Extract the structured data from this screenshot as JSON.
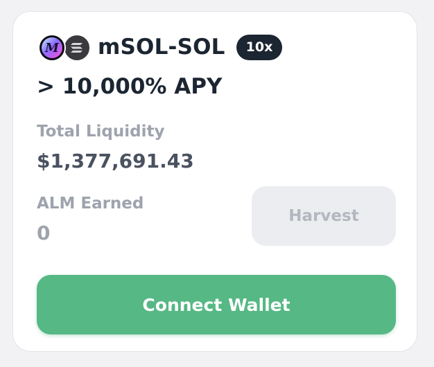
{
  "pool": {
    "token_a_icon": "msol-token-icon",
    "token_b_icon": "sol-token-icon",
    "pair_name": "mSOL-SOL",
    "leverage": "10x",
    "apy": "> 10,000% APY"
  },
  "stats": {
    "liquidity_label": "Total Liquidity",
    "liquidity_value": "$1,377,691.43",
    "earned_label": "ALM Earned",
    "earned_value": "0"
  },
  "actions": {
    "harvest_label": "Harvest",
    "connect_label": "Connect Wallet"
  },
  "colors": {
    "primary_text": "#1c2532",
    "muted_text": "#9ea3ad",
    "connect_green": "#56b884",
    "disabled_bg": "#ecedf0"
  }
}
